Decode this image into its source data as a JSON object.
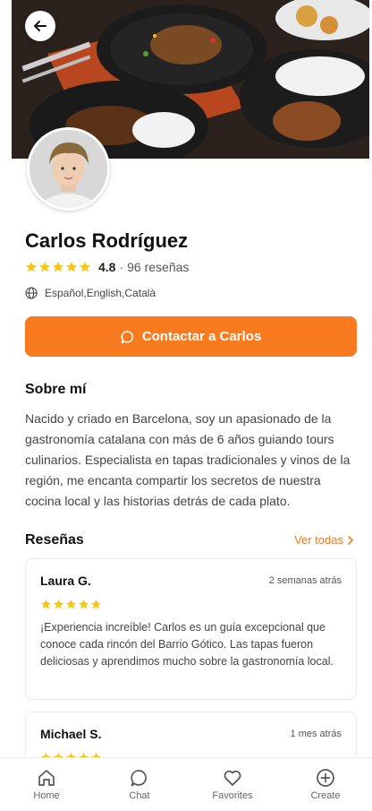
{
  "profile": {
    "name": "Carlos Rodríguez",
    "rating": "4.8",
    "rating_separator": "·",
    "review_count": "96 reseñas",
    "stars": 5,
    "languages": "Español,English,Català"
  },
  "actions": {
    "contact_label": "Contactar a Carlos"
  },
  "about": {
    "title": "Sobre mí",
    "text": "Nacido y criado en Barcelona, soy un apasionado de la gastronomía catalana con más de 6 años guiando tours culinarios. Especialista en tapas tradicionales y vinos de la región, me encanta compartir los secretos de nuestra cocina local y las historias detrás de cada plato."
  },
  "reviews": {
    "title": "Reseñas",
    "see_all": "Ver todas",
    "items": [
      {
        "author": "Laura G.",
        "date": "2 semanas atrás",
        "stars": 5,
        "text": "¡Experiencia increíble! Carlos es un guía excepcional que conoce cada rincón del Barrio Gótico. Las tapas fueron deliciosas y aprendimos mucho sobre la gastronomía local."
      },
      {
        "author": "Michael S.",
        "date": "1 mes atrás",
        "stars": 5,
        "text": ""
      }
    ]
  },
  "nav": {
    "items": [
      {
        "label": "Home",
        "icon": "home-icon"
      },
      {
        "label": "Chat",
        "icon": "chat-icon"
      },
      {
        "label": "Favorites",
        "icon": "heart-icon"
      },
      {
        "label": "Create",
        "icon": "plus-circle-icon"
      }
    ]
  },
  "colors": {
    "accent": "#f97a1f",
    "star": "#f5c518"
  }
}
